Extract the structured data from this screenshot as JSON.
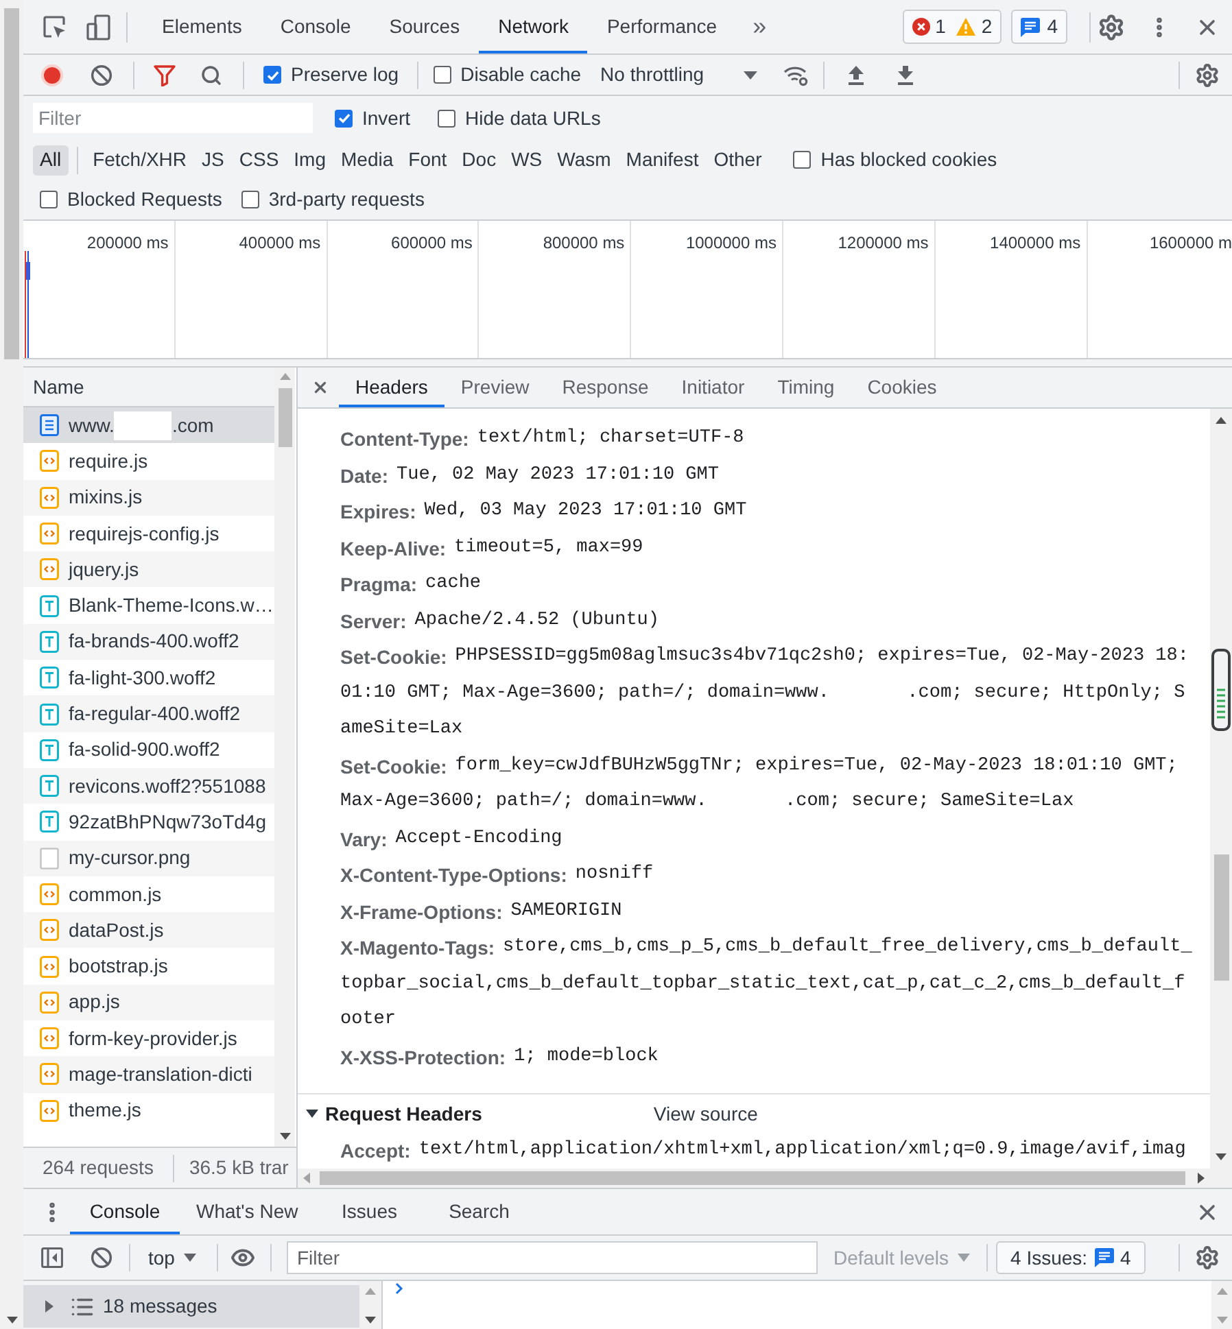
{
  "main_tabs": [
    {
      "label": "Elements",
      "selected": false
    },
    {
      "label": "Console",
      "selected": false
    },
    {
      "label": "Sources",
      "selected": false
    },
    {
      "label": "Network",
      "selected": true
    },
    {
      "label": "Performance",
      "selected": false
    }
  ],
  "more_tabs": "»",
  "counters": {
    "errors": "1",
    "warnings": "2",
    "issues": "4"
  },
  "network_toolbar": {
    "recording": true,
    "filter_active": true,
    "preserve_log": {
      "label": "Preserve log",
      "checked": true
    },
    "disable_cache": {
      "label": "Disable cache",
      "checked": false
    },
    "throttling": "No throttling"
  },
  "filter_row": {
    "filter": {
      "placeholder": "Filter"
    },
    "options": [
      {
        "label": "Invert",
        "checked": true
      },
      {
        "label": "Hide data URLs",
        "checked": false
      }
    ]
  },
  "type_filters": [
    {
      "label": "All",
      "selected": true
    },
    {
      "label": "Fetch/XHR",
      "selected": false
    },
    {
      "label": "JS",
      "selected": false
    },
    {
      "label": "CSS",
      "selected": false
    },
    {
      "label": "Img",
      "selected": false
    },
    {
      "label": "Media",
      "selected": false
    },
    {
      "label": "Font",
      "selected": false
    },
    {
      "label": "Doc",
      "selected": false
    },
    {
      "label": "WS",
      "selected": false
    },
    {
      "label": "Wasm",
      "selected": false
    },
    {
      "label": "Manifest",
      "selected": false
    },
    {
      "label": "Other",
      "selected": false
    }
  ],
  "blocked_cookies": {
    "label": "Has blocked cookies",
    "checked": false
  },
  "request_filters": [
    {
      "label": "Blocked Requests",
      "checked": false
    },
    {
      "label": "3rd-party requests",
      "checked": false
    }
  ],
  "timeline": {
    "ticks": [
      "200000 ms",
      "400000 ms",
      "600000 ms",
      "800000 ms",
      "1000000 ms",
      "1200000 ms",
      "1400000 ms",
      "1600000 m"
    ]
  },
  "requests": {
    "column": "Name",
    "rows": [
      {
        "name": [
          "www.",
          ".com"
        ],
        "kind": "document",
        "selected": true
      },
      {
        "name": [
          "require.js"
        ],
        "kind": "script",
        "selected": false
      },
      {
        "name": [
          "mixins.js"
        ],
        "kind": "script",
        "selected": false
      },
      {
        "name": [
          "requirejs-config.js"
        ],
        "kind": "script",
        "selected": false
      },
      {
        "name": [
          "jquery.js"
        ],
        "kind": "script",
        "selected": false
      },
      {
        "name": [
          "Blank-Theme-Icons.w…"
        ],
        "kind": "font",
        "selected": false
      },
      {
        "name": [
          "fa-brands-400.woff2"
        ],
        "kind": "font",
        "selected": false
      },
      {
        "name": [
          "fa-light-300.woff2"
        ],
        "kind": "font",
        "selected": false
      },
      {
        "name": [
          "fa-regular-400.woff2"
        ],
        "kind": "font",
        "selected": false
      },
      {
        "name": [
          "fa-solid-900.woff2"
        ],
        "kind": "font",
        "selected": false
      },
      {
        "name": [
          "revicons.woff2?551088"
        ],
        "kind": "font",
        "selected": false
      },
      {
        "name": [
          "92zatBhPNqw73oTd4g"
        ],
        "kind": "font",
        "selected": false
      },
      {
        "name": [
          "my-cursor.png"
        ],
        "kind": "image",
        "selected": false
      },
      {
        "name": [
          "common.js"
        ],
        "kind": "script",
        "selected": false
      },
      {
        "name": [
          "dataPost.js"
        ],
        "kind": "script",
        "selected": false
      },
      {
        "name": [
          "bootstrap.js"
        ],
        "kind": "script",
        "selected": false
      },
      {
        "name": [
          "app.js"
        ],
        "kind": "script",
        "selected": false
      },
      {
        "name": [
          "form-key-provider.js"
        ],
        "kind": "script",
        "selected": false
      },
      {
        "name": [
          "mage-translation-dicti"
        ],
        "kind": "script",
        "selected": false
      },
      {
        "name": [
          "theme.js"
        ],
        "kind": "script",
        "selected": false
      }
    ],
    "summary": [
      "264 requests",
      "36.5 kB trar"
    ]
  },
  "details": {
    "tabs": [
      {
        "label": "Headers",
        "selected": true
      },
      {
        "label": "Preview",
        "selected": false
      },
      {
        "label": "Response",
        "selected": false
      },
      {
        "label": "Initiator",
        "selected": false
      },
      {
        "label": "Timing",
        "selected": false
      },
      {
        "label": "Cookies",
        "selected": false
      }
    ],
    "response_headers": [
      {
        "name": "Content-Type:",
        "value": [
          "text/html; charset=UTF-8"
        ]
      },
      {
        "name": "Date:",
        "value": [
          "Tue, 02 May 2023 17:01:10 GMT"
        ]
      },
      {
        "name": "Expires:",
        "value": [
          "Wed, 03 May 2023 17:01:10 GMT"
        ]
      },
      {
        "name": "Keep-Alive:",
        "value": [
          "timeout=5, max=99"
        ]
      },
      {
        "name": "Pragma:",
        "value": [
          "cache"
        ]
      },
      {
        "name": "Server:",
        "value": [
          "Apache/2.4.52 (Ubuntu)"
        ]
      },
      {
        "name": "Set-Cookie:",
        "value": [
          "PHPSESSID=gg5m08aglmsuc3s4bv71qc2sh0; expires=Tue, 02-May-2023 18:01:10 GMT; Max-Age=3600; path=/; domain=www.",
          ".com; secure; HttpOnly; SameSite=Lax"
        ]
      },
      {
        "name": "Set-Cookie:",
        "value": [
          "form_key=cwJdfBUHzW5ggTNr; expires=Tue, 02-May-2023 18:01:10 GMT; Max-Age=3600; path=/; domain=www.",
          ".com; secure; SameSite=Lax"
        ]
      },
      {
        "name": "Vary:",
        "value": [
          "Accept-Encoding"
        ]
      },
      {
        "name": "X-Content-Type-Options:",
        "value": [
          "nosniff"
        ]
      },
      {
        "name": "X-Frame-Options:",
        "value": [
          "SAMEORIGIN"
        ]
      },
      {
        "name": "X-Magento-Tags:",
        "value": [
          "store,cms_b,cms_p_5,cms_b_default_free_delivery,cms_b_default_topbar_social,cms_b_default_topbar_static_text,cat_p,cat_c_2,cms_b_default_footer"
        ]
      },
      {
        "name": "X-XSS-Protection:",
        "value": [
          "1; mode=block"
        ]
      }
    ],
    "request_headers": {
      "title": "Request Headers",
      "expanded": true,
      "view_source": "View source",
      "headers": [
        {
          "name": "Accept:",
          "value": [
            "text/html,application/xhtml+xml,application/xml;q=0.9,image/avif,imag"
          ]
        }
      ]
    }
  },
  "drawer": {
    "tabs": [
      {
        "label": "Console",
        "selected": true
      },
      {
        "label": "What's New",
        "selected": false
      },
      {
        "label": "Issues",
        "selected": false
      },
      {
        "label": "Search",
        "selected": false
      }
    ],
    "context": "top",
    "filter": {
      "placeholder": "Filter"
    },
    "levels": "Default levels",
    "issues_button": {
      "label": "4 Issues:",
      "count": "4"
    },
    "sidebar": [
      {
        "label": "18 messages",
        "selected": true,
        "expanded": false
      }
    ]
  }
}
